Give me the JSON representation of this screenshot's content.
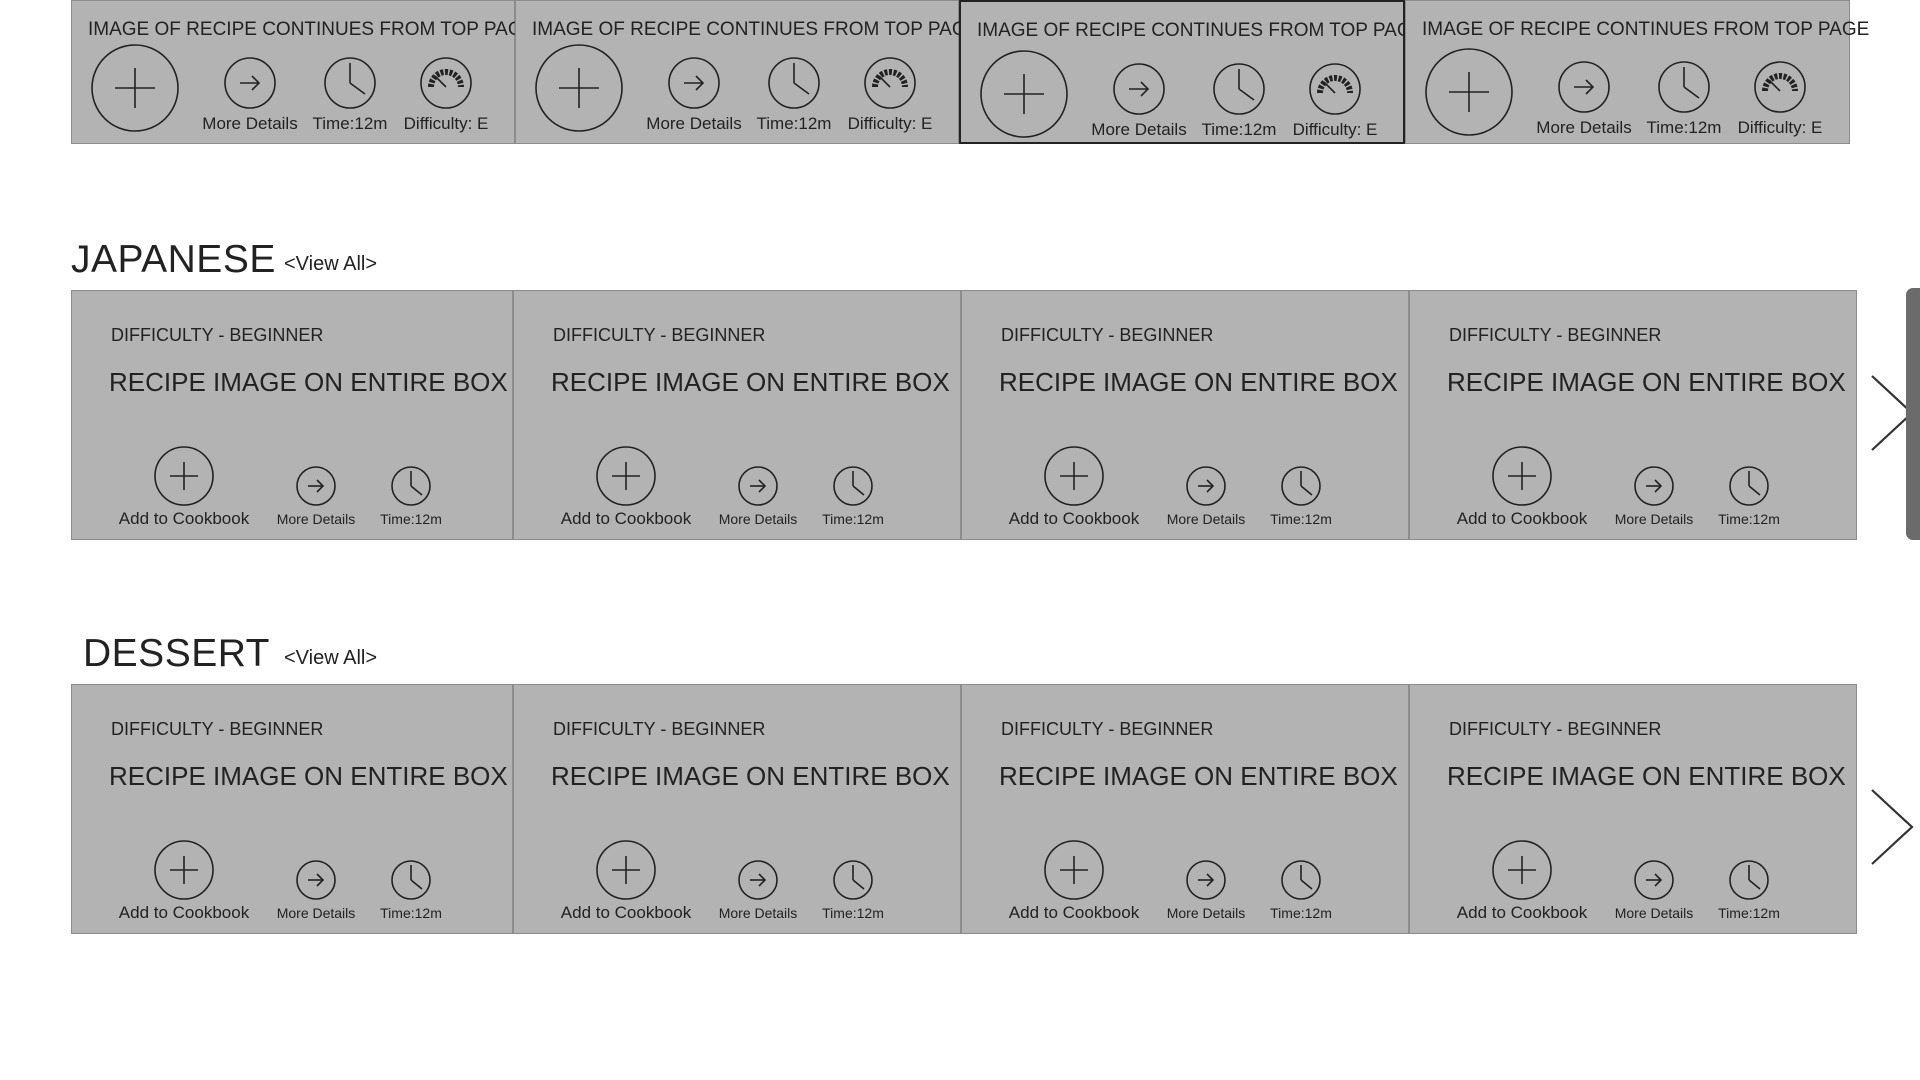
{
  "top_row": {
    "cards": [
      {
        "title": "IMAGE OF RECIPE CONTINUES FROM TOP PAGE",
        "more_label": "More Details",
        "time_label": "Time:12m",
        "difficulty_label": "Difficulty: E"
      },
      {
        "title": "IMAGE OF RECIPE CONTINUES FROM TOP PAGE",
        "more_label": "More Details",
        "time_label": "Time:12m",
        "difficulty_label": "Difficulty: E"
      },
      {
        "title": "IMAGE OF RECIPE CONTINUES FROM TOP PAGE",
        "more_label": "More Details",
        "time_label": "Time:12m",
        "difficulty_label": "Difficulty: E"
      },
      {
        "title": "IMAGE OF RECIPE CONTINUES FROM TOP PAGE",
        "more_label": "More Details",
        "time_label": "Time:12m",
        "difficulty_label": "Difficulty: E"
      }
    ]
  },
  "sections": {
    "japanese": {
      "title": "JAPANESE",
      "view_all": "<View All>",
      "cards": [
        {
          "difficulty": "DIFFICULTY - BEGINNER",
          "image_text": "RECIPE IMAGE ON ENTIRE BOX",
          "add_label": "Add to Cookbook",
          "more_label": "More Details",
          "time_label": "Time:12m"
        },
        {
          "difficulty": "DIFFICULTY - BEGINNER",
          "image_text": "RECIPE IMAGE ON ENTIRE BOX",
          "add_label": "Add to Cookbook",
          "more_label": "More Details",
          "time_label": "Time:12m"
        },
        {
          "difficulty": "DIFFICULTY - BEGINNER",
          "image_text": "RECIPE IMAGE ON ENTIRE BOX",
          "add_label": "Add to Cookbook",
          "more_label": "More Details",
          "time_label": "Time:12m"
        },
        {
          "difficulty": "DIFFICULTY - BEGINNER",
          "image_text": "RECIPE IMAGE ON ENTIRE BOX",
          "add_label": "Add to Cookbook",
          "more_label": "More Details",
          "time_label": "Time:12m"
        }
      ]
    },
    "dessert": {
      "title": "DESSERT",
      "view_all": "<View All>",
      "cards": [
        {
          "difficulty": "DIFFICULTY - BEGINNER",
          "image_text": "RECIPE IMAGE ON ENTIRE BOX",
          "add_label": "Add to Cookbook",
          "more_label": "More Details",
          "time_label": "Time:12m"
        },
        {
          "difficulty": "DIFFICULTY - BEGINNER",
          "image_text": "RECIPE IMAGE ON ENTIRE BOX",
          "add_label": "Add to Cookbook",
          "more_label": "More Details",
          "time_label": "Time:12m"
        },
        {
          "difficulty": "DIFFICULTY - BEGINNER",
          "image_text": "RECIPE IMAGE ON ENTIRE BOX",
          "add_label": "Add to Cookbook",
          "more_label": "More Details",
          "time_label": "Time:12m"
        },
        {
          "difficulty": "DIFFICULTY - BEGINNER",
          "image_text": "RECIPE IMAGE ON ENTIRE BOX",
          "add_label": "Add to Cookbook",
          "more_label": "More Details",
          "time_label": "Time:12m"
        }
      ]
    }
  },
  "icons": {
    "add": "plus-circle-icon",
    "more": "arrow-right-circle-icon",
    "time": "clock-icon",
    "difficulty": "gauge-icon",
    "next": "chevron-right-icon"
  },
  "colors": {
    "card_fill": "#b3b3b3",
    "card_border": "#8c8c8c",
    "text": "#222222",
    "scrollbar_thumb": "#6b6b6b"
  }
}
